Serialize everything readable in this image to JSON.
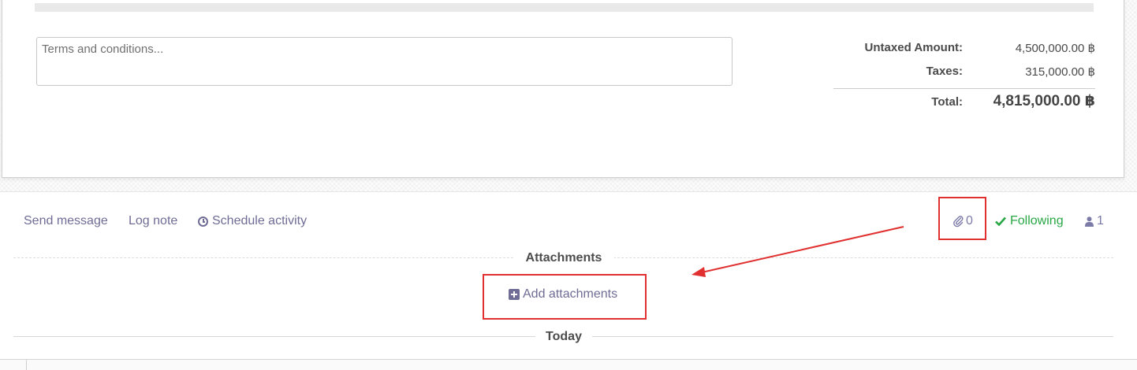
{
  "form": {
    "terms_placeholder": "Terms and conditions...",
    "totals": {
      "untaxed_label": "Untaxed Amount:",
      "untaxed_value": "4,500,000.00 ฿",
      "taxes_label": "Taxes:",
      "taxes_value": "315,000.00 ฿",
      "total_label": "Total:",
      "total_value": "4,815,000.00 ฿"
    }
  },
  "chatter": {
    "send_message": "Send message",
    "log_note": "Log note",
    "schedule_activity": "Schedule activity",
    "attachment_count": "0",
    "following": "Following",
    "follower_count": "1",
    "attachments_title": "Attachments",
    "add_attachments": "Add attachments",
    "today_label": "Today"
  },
  "colors": {
    "link": "#6f6c95",
    "following": "#28a745",
    "annotation": "#e03030"
  },
  "icons": [
    "clock-icon",
    "paperclip-icon",
    "check-icon",
    "user-icon",
    "plus-square-icon"
  ]
}
